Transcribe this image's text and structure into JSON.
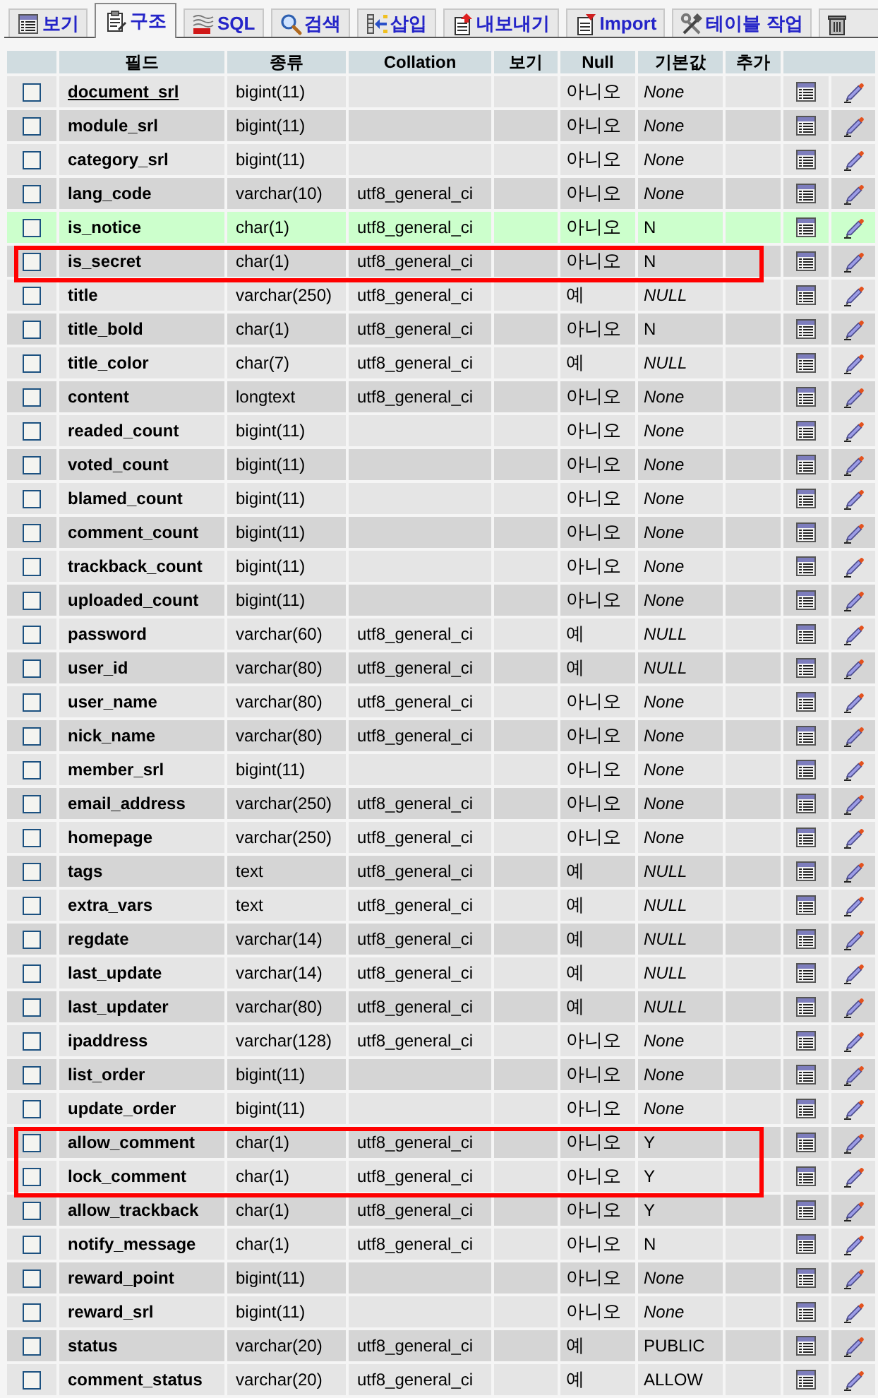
{
  "tabs": [
    {
      "kind": "browse",
      "label": "보기",
      "selected": false
    },
    {
      "kind": "structure",
      "label": "구조",
      "selected": true
    },
    {
      "kind": "sql",
      "label": "SQL",
      "selected": false
    },
    {
      "kind": "search",
      "label": "검색",
      "selected": false
    },
    {
      "kind": "insert",
      "label": "삽입",
      "selected": false
    },
    {
      "kind": "export",
      "label": "내보내기",
      "selected": false
    },
    {
      "kind": "import",
      "label": "Import",
      "selected": false
    },
    {
      "kind": "operations",
      "label": "테이블 작업",
      "selected": false
    },
    {
      "kind": "trash",
      "selected": false
    }
  ],
  "table": {
    "columns": [
      "필드",
      "종류",
      "Collation",
      "보기",
      "Null",
      "기본값",
      "추가"
    ],
    "rows": [
      {
        "field": "document_srl",
        "primary": true,
        "type": "bigint(11)",
        "null": "아니오",
        "default": "None",
        "default_keyword": true,
        "checked": false,
        "hovered": false,
        "annotated": false
      },
      {
        "field": "module_srl",
        "primary": false,
        "type": "bigint(11)",
        "null": "아니오",
        "default": "None",
        "default_keyword": true,
        "checked": false,
        "hovered": false,
        "annotated": false
      },
      {
        "field": "category_srl",
        "primary": false,
        "type": "bigint(11)",
        "null": "아니오",
        "default": "None",
        "default_keyword": true,
        "checked": false,
        "hovered": false,
        "annotated": false
      },
      {
        "field": "lang_code",
        "primary": false,
        "type": "varchar(10)",
        "collation": "utf8_general_ci",
        "null": "아니오",
        "default": "None",
        "default_keyword": true,
        "checked": false,
        "hovered": false,
        "annotated": false
      },
      {
        "field": "is_notice",
        "primary": false,
        "type": "char(1)",
        "collation": "utf8_general_ci",
        "null": "아니오",
        "default": "N",
        "default_keyword": false,
        "checked": false,
        "hovered": true,
        "annotated": false
      },
      {
        "field": "is_secret",
        "primary": false,
        "type": "char(1)",
        "collation": "utf8_general_ci",
        "null": "아니오",
        "default": "N",
        "default_keyword": false,
        "checked": false,
        "hovered": false,
        "annotated": true
      },
      {
        "field": "title",
        "primary": false,
        "type": "varchar(250)",
        "collation": "utf8_general_ci",
        "null": "예",
        "default": "NULL",
        "default_keyword": true,
        "checked": false,
        "hovered": false,
        "annotated": false
      },
      {
        "field": "title_bold",
        "primary": false,
        "type": "char(1)",
        "collation": "utf8_general_ci",
        "null": "아니오",
        "default": "N",
        "default_keyword": false,
        "checked": false,
        "hovered": false,
        "annotated": false
      },
      {
        "field": "title_color",
        "primary": false,
        "type": "char(7)",
        "collation": "utf8_general_ci",
        "null": "예",
        "default": "NULL",
        "default_keyword": true,
        "checked": false,
        "hovered": false,
        "annotated": false
      },
      {
        "field": "content",
        "primary": false,
        "type": "longtext",
        "collation": "utf8_general_ci",
        "null": "아니오",
        "default": "None",
        "default_keyword": true,
        "checked": false,
        "hovered": false,
        "annotated": false
      },
      {
        "field": "readed_count",
        "primary": false,
        "type": "bigint(11)",
        "null": "아니오",
        "default": "None",
        "default_keyword": true,
        "checked": false,
        "hovered": false,
        "annotated": false
      },
      {
        "field": "voted_count",
        "primary": false,
        "type": "bigint(11)",
        "null": "아니오",
        "default": "None",
        "default_keyword": true,
        "checked": false,
        "hovered": false,
        "annotated": false
      },
      {
        "field": "blamed_count",
        "primary": false,
        "type": "bigint(11)",
        "null": "아니오",
        "default": "None",
        "default_keyword": true,
        "checked": false,
        "hovered": false,
        "annotated": false
      },
      {
        "field": "comment_count",
        "primary": false,
        "type": "bigint(11)",
        "null": "아니오",
        "default": "None",
        "default_keyword": true,
        "checked": false,
        "hovered": false,
        "annotated": false
      },
      {
        "field": "trackback_count",
        "primary": false,
        "type": "bigint(11)",
        "null": "아니오",
        "default": "None",
        "default_keyword": true,
        "checked": false,
        "hovered": false,
        "annotated": false
      },
      {
        "field": "uploaded_count",
        "primary": false,
        "type": "bigint(11)",
        "null": "아니오",
        "default": "None",
        "default_keyword": true,
        "checked": false,
        "hovered": false,
        "annotated": false
      },
      {
        "field": "password",
        "primary": false,
        "type": "varchar(60)",
        "collation": "utf8_general_ci",
        "null": "예",
        "default": "NULL",
        "default_keyword": true,
        "checked": false,
        "hovered": false,
        "annotated": false
      },
      {
        "field": "user_id",
        "primary": false,
        "type": "varchar(80)",
        "collation": "utf8_general_ci",
        "null": "예",
        "default": "NULL",
        "default_keyword": true,
        "checked": false,
        "hovered": false,
        "annotated": false
      },
      {
        "field": "user_name",
        "primary": false,
        "type": "varchar(80)",
        "collation": "utf8_general_ci",
        "null": "아니오",
        "default": "None",
        "default_keyword": true,
        "checked": false,
        "hovered": false,
        "annotated": false
      },
      {
        "field": "nick_name",
        "primary": false,
        "type": "varchar(80)",
        "collation": "utf8_general_ci",
        "null": "아니오",
        "default": "None",
        "default_keyword": true,
        "checked": false,
        "hovered": false,
        "annotated": false
      },
      {
        "field": "member_srl",
        "primary": false,
        "type": "bigint(11)",
        "null": "아니오",
        "default": "None",
        "default_keyword": true,
        "checked": false,
        "hovered": false,
        "annotated": false
      },
      {
        "field": "email_address",
        "primary": false,
        "type": "varchar(250)",
        "collation": "utf8_general_ci",
        "null": "아니오",
        "default": "None",
        "default_keyword": true,
        "checked": false,
        "hovered": false,
        "annotated": false
      },
      {
        "field": "homepage",
        "primary": false,
        "type": "varchar(250)",
        "collation": "utf8_general_ci",
        "null": "아니오",
        "default": "None",
        "default_keyword": true,
        "checked": false,
        "hovered": false,
        "annotated": false
      },
      {
        "field": "tags",
        "primary": false,
        "type": "text",
        "collation": "utf8_general_ci",
        "null": "예",
        "default": "NULL",
        "default_keyword": true,
        "checked": false,
        "hovered": false,
        "annotated": false
      },
      {
        "field": "extra_vars",
        "primary": false,
        "type": "text",
        "collation": "utf8_general_ci",
        "null": "예",
        "default": "NULL",
        "default_keyword": true,
        "checked": false,
        "hovered": false,
        "annotated": false
      },
      {
        "field": "regdate",
        "primary": false,
        "type": "varchar(14)",
        "collation": "utf8_general_ci",
        "null": "예",
        "default": "NULL",
        "default_keyword": true,
        "checked": false,
        "hovered": false,
        "annotated": false
      },
      {
        "field": "last_update",
        "primary": false,
        "type": "varchar(14)",
        "collation": "utf8_general_ci",
        "null": "예",
        "default": "NULL",
        "default_keyword": true,
        "checked": false,
        "hovered": false,
        "annotated": false
      },
      {
        "field": "last_updater",
        "primary": false,
        "type": "varchar(80)",
        "collation": "utf8_general_ci",
        "null": "예",
        "default": "NULL",
        "default_keyword": true,
        "checked": false,
        "hovered": false,
        "annotated": false
      },
      {
        "field": "ipaddress",
        "primary": false,
        "type": "varchar(128)",
        "collation": "utf8_general_ci",
        "null": "아니오",
        "default": "None",
        "default_keyword": true,
        "checked": false,
        "hovered": false,
        "annotated": false
      },
      {
        "field": "list_order",
        "primary": false,
        "type": "bigint(11)",
        "null": "아니오",
        "default": "None",
        "default_keyword": true,
        "checked": false,
        "hovered": false,
        "annotated": false
      },
      {
        "field": "update_order",
        "primary": false,
        "type": "bigint(11)",
        "null": "아니오",
        "default": "None",
        "default_keyword": true,
        "checked": false,
        "hovered": false,
        "annotated": false
      },
      {
        "field": "allow_comment",
        "primary": false,
        "type": "char(1)",
        "collation": "utf8_general_ci",
        "null": "아니오",
        "default": "Y",
        "default_keyword": false,
        "checked": false,
        "hovered": false,
        "annotated": true
      },
      {
        "field": "lock_comment",
        "primary": false,
        "type": "char(1)",
        "collation": "utf8_general_ci",
        "null": "아니오",
        "default": "Y",
        "default_keyword": false,
        "checked": false,
        "hovered": false,
        "annotated": true
      },
      {
        "field": "allow_trackback",
        "primary": false,
        "type": "char(1)",
        "collation": "utf8_general_ci",
        "null": "아니오",
        "default": "Y",
        "default_keyword": false,
        "checked": false,
        "hovered": false,
        "annotated": false
      },
      {
        "field": "notify_message",
        "primary": false,
        "type": "char(1)",
        "collation": "utf8_general_ci",
        "null": "아니오",
        "default": "N",
        "default_keyword": false,
        "checked": false,
        "hovered": false,
        "annotated": false
      },
      {
        "field": "reward_point",
        "primary": false,
        "type": "bigint(11)",
        "null": "아니오",
        "default": "None",
        "default_keyword": true,
        "checked": false,
        "hovered": false,
        "annotated": false
      },
      {
        "field": "reward_srl",
        "primary": false,
        "type": "bigint(11)",
        "null": "아니오",
        "default": "None",
        "default_keyword": true,
        "checked": false,
        "hovered": false,
        "annotated": false
      },
      {
        "field": "status",
        "primary": false,
        "type": "varchar(20)",
        "collation": "utf8_general_ci",
        "null": "예",
        "default": "PUBLIC",
        "default_keyword": false,
        "checked": false,
        "hovered": false,
        "annotated": false
      },
      {
        "field": "comment_status",
        "primary": false,
        "type": "varchar(20)",
        "collation": "utf8_general_ci",
        "null": "예",
        "default": "ALLOW",
        "default_keyword": false,
        "checked": false,
        "hovered": false,
        "annotated": false
      }
    ]
  }
}
